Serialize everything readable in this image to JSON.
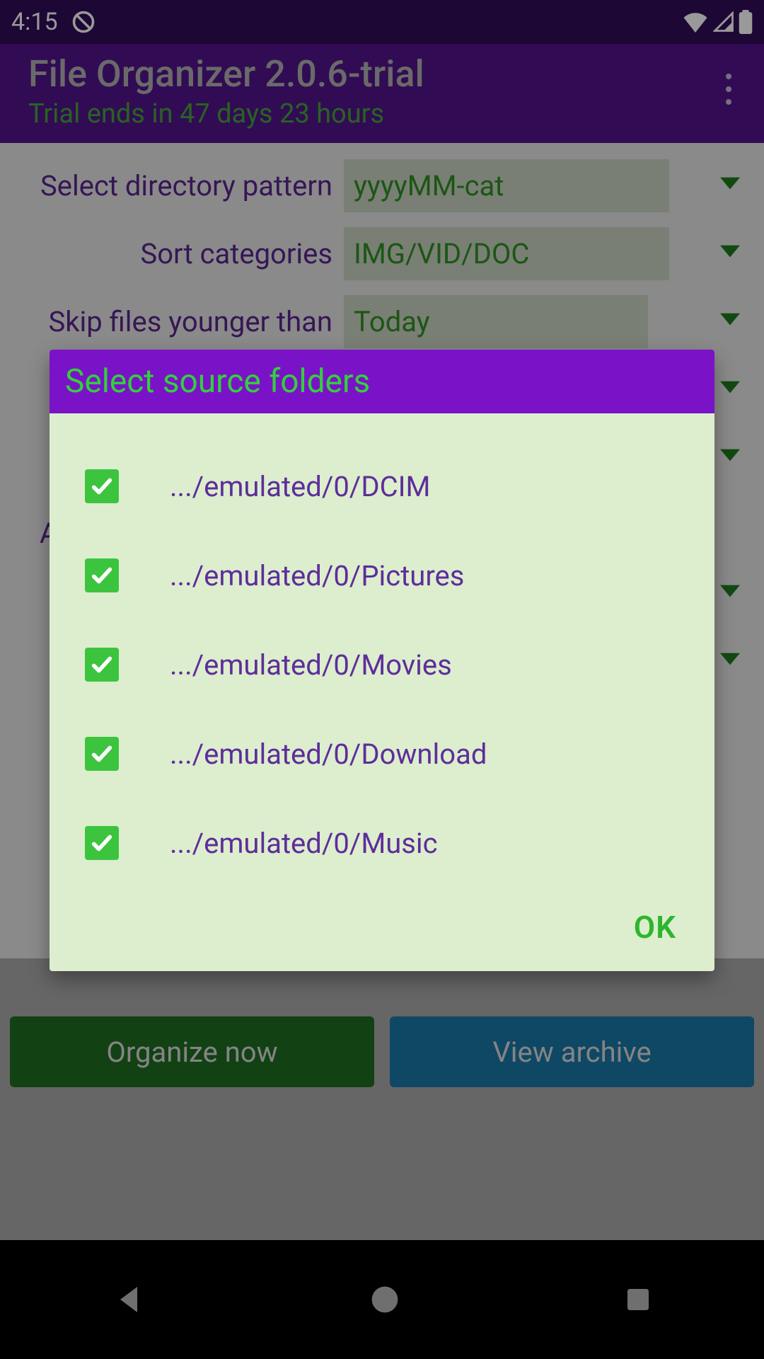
{
  "status_bar": {
    "time": "4:15"
  },
  "app_bar": {
    "title": "File Organizer 2.0.6-trial",
    "subtitle": "Trial ends in 47 days 23 hours"
  },
  "settings": {
    "rows": [
      {
        "label": "Select directory pattern",
        "value": "yyyyMM-cat"
      },
      {
        "label": "Sort categories",
        "value": "IMG/VID/DOC"
      },
      {
        "label": "Skip files younger than",
        "value": "Today"
      }
    ],
    "partial_row_char": "A"
  },
  "buttons": {
    "organize": "Organize now",
    "view_archive": "View archive"
  },
  "dialog": {
    "title": "Select source folders",
    "folders": [
      {
        "checked": true,
        "label": ".../emulated/0/DCIM"
      },
      {
        "checked": true,
        "label": ".../emulated/0/Pictures"
      },
      {
        "checked": true,
        "label": ".../emulated/0/Movies"
      },
      {
        "checked": true,
        "label": ".../emulated/0/Download"
      },
      {
        "checked": true,
        "label": ".../emulated/0/Music"
      }
    ],
    "ok": "OK"
  },
  "colors": {
    "status_bg": "#2f0c59",
    "appbar_bg": "#52148c",
    "accent_green": "#3cc43f",
    "dialog_bg": "#dceecd",
    "dialog_header": "#7a13c7"
  }
}
